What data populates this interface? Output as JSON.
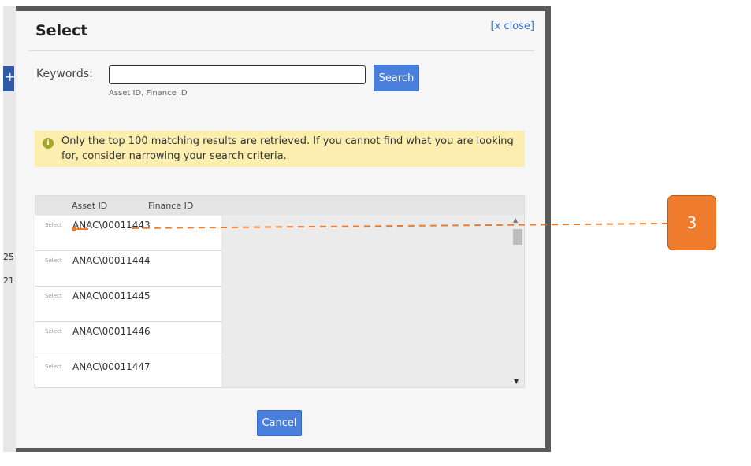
{
  "background": {
    "numbers": [
      "25",
      "21"
    ]
  },
  "modal": {
    "title": "Select",
    "close_label": "[x close]"
  },
  "search": {
    "label": "Keywords:",
    "value": "",
    "placeholder": "",
    "hint": "Asset ID, Finance ID",
    "button_label": "Search"
  },
  "notice": {
    "icon": "info-icon",
    "text": "Only the top 100 matching results are retrieved. If you cannot find what you are looking for, consider narrowing your search criteria."
  },
  "results": {
    "columns": [
      "Asset ID",
      "Finance ID"
    ],
    "select_label": "Select",
    "rows": [
      {
        "asset_id": "ANAC\\00011443",
        "finance_id": ""
      },
      {
        "asset_id": "ANAC\\00011444",
        "finance_id": ""
      },
      {
        "asset_id": "ANAC\\00011445",
        "finance_id": ""
      },
      {
        "asset_id": "ANAC\\00011446",
        "finance_id": ""
      },
      {
        "asset_id": "ANAC\\00011447",
        "finance_id": ""
      }
    ]
  },
  "footer": {
    "cancel_label": "Cancel"
  },
  "callout": {
    "number": "3",
    "color": "#ef7c2c"
  }
}
